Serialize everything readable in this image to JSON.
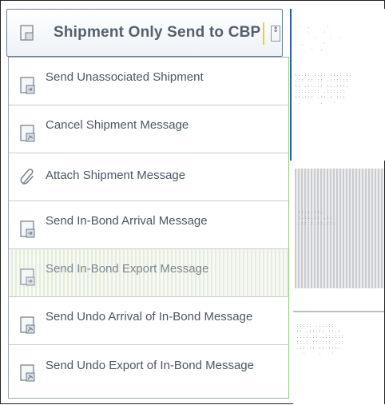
{
  "dropdown": {
    "selected_label": "Shipment Only Send to CBP",
    "header_icon": "document-icon",
    "arrow_glyph": "⇕",
    "items": [
      {
        "label": "Send Unassociated Shipment",
        "icon": "document-send-icon"
      },
      {
        "label": "Cancel Shipment Message",
        "icon": "document-cancel-icon"
      },
      {
        "label": "Attach Shipment Message",
        "icon": "paperclip-icon"
      },
      {
        "label": "Send In-Bond Arrival Message",
        "icon": "document-send-icon"
      },
      {
        "label": "Send In-Bond Export Message",
        "icon": "document-send-icon"
      },
      {
        "label": "Send Undo Arrival of In-Bond Message",
        "icon": "document-undo-icon"
      },
      {
        "label": "Send Undo Export of In-Bond Message",
        "icon": "document-undo-icon"
      }
    ]
  },
  "colors": {
    "header_text": "#55606e",
    "item_text": "#4c5663",
    "accent_yellow": "#f0d020",
    "menu_border_green": "#8fd17a",
    "panel_border_blue": "#2c5fa0"
  }
}
